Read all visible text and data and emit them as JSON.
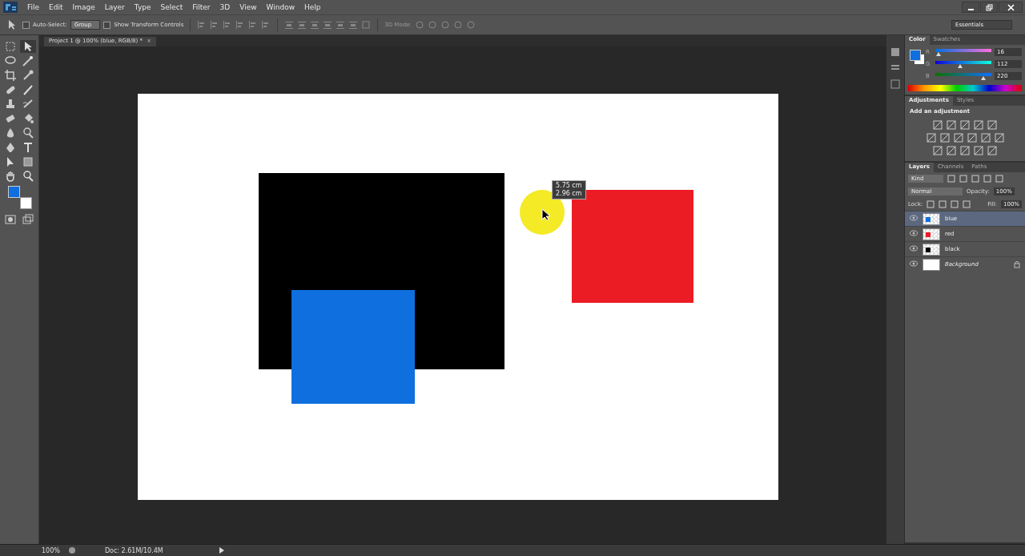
{
  "menu": [
    "File",
    "Edit",
    "Image",
    "Layer",
    "Type",
    "Select",
    "Filter",
    "3D",
    "View",
    "Window",
    "Help"
  ],
  "options_bar": {
    "auto_select": {
      "label": "Auto-Select:",
      "checked": false
    },
    "target": "Group",
    "show_transform": {
      "label": "Show Transform Controls",
      "checked": false
    },
    "mode_label": "3D Mode:",
    "workspace": "Essentials"
  },
  "document_tab": {
    "title": "Project 1 @ 100% (blue, RGB/8) *",
    "close": "×"
  },
  "canvas": {
    "shapes": [
      {
        "color": "#000000"
      },
      {
        "color": "#0f6fdf"
      },
      {
        "color": "#ec1c24"
      }
    ],
    "tooltip": {
      "lines": [
        "5.75 cm",
        "2.96 cm"
      ]
    }
  },
  "color_panel": {
    "tabs": [
      {
        "label": "Color",
        "selected": true
      },
      {
        "label": "Swatches",
        "selected": false
      }
    ],
    "channels": [
      {
        "name": "R",
        "value": "16",
        "level": 0.06
      },
      {
        "name": "G",
        "value": "112",
        "level": 0.44
      },
      {
        "name": "B",
        "value": "220",
        "level": 0.86
      }
    ]
  },
  "adjustments_panel": {
    "tabs": [
      {
        "label": "Adjustments",
        "selected": true
      },
      {
        "label": "Styles",
        "selected": false
      }
    ],
    "heading": "Add an adjustment"
  },
  "layers_panel": {
    "tabs": [
      {
        "label": "Layers",
        "selected": true
      },
      {
        "label": "Channels",
        "selected": false
      },
      {
        "label": "Paths",
        "selected": false
      }
    ],
    "filter": "Kind",
    "blend_mode": "Normal",
    "opacity_label": "Opacity:",
    "opacity": "100%",
    "lock_label": "Lock:",
    "fill_label": "Fill:",
    "fill": "100%",
    "layers": [
      {
        "name": "blue",
        "selected": true,
        "kind": "layer",
        "color": "#0f6fdf"
      },
      {
        "name": "red",
        "selected": false,
        "kind": "layer",
        "color": "#ec1c24"
      },
      {
        "name": "black",
        "selected": false,
        "kind": "layer",
        "color": "#000000"
      },
      {
        "name": "Background",
        "selected": false,
        "kind": "background",
        "color": "#ffffff"
      }
    ]
  },
  "status_bar": {
    "zoom": "100%",
    "doc": "Doc: 2.61M/10.4M"
  }
}
